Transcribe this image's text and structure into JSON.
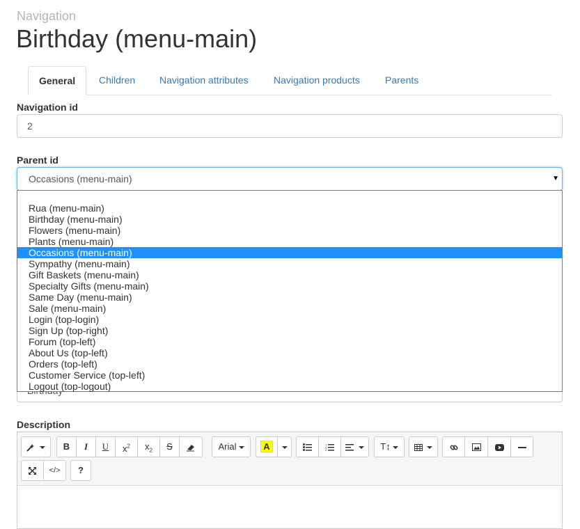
{
  "breadcrumb": "Navigation",
  "page_title": "Birthday (menu-main)",
  "tabs": [
    "General",
    "Children",
    "Navigation attributes",
    "Navigation products",
    "Parents"
  ],
  "fields": {
    "navigation_id": {
      "label": "Navigation id",
      "value": "2"
    },
    "parent_id": {
      "label": "Parent id",
      "value": "Occasions (menu-main)"
    },
    "behind_value": "Birthday",
    "description": {
      "label": "Description"
    }
  },
  "dropdown_options": [
    "Rua (menu-main)",
    "Birthday (menu-main)",
    "Flowers (menu-main)",
    "Plants (menu-main)",
    "Occasions (menu-main)",
    "Sympathy (menu-main)",
    "Gift Baskets (menu-main)",
    "Specialty Gifts (menu-main)",
    "Same Day (menu-main)",
    "Sale (menu-main)",
    "Login (top-login)",
    "Sign Up (top-right)",
    "Forum (top-left)",
    "About Us (top-left)",
    "Orders (top-left)",
    "Customer Service (top-left)",
    "Logout (top-logout)"
  ],
  "selected_option": "Occasions (menu-main)",
  "toolbar": {
    "font_name": "Arial",
    "help": "?",
    "bold": "B",
    "italic": "I",
    "underline": "U",
    "highlight": "A",
    "text_size": "T"
  },
  "colors": {
    "link": "#337ab7",
    "selected_option": "#1e90ff",
    "focus_border": "#66afe9"
  }
}
